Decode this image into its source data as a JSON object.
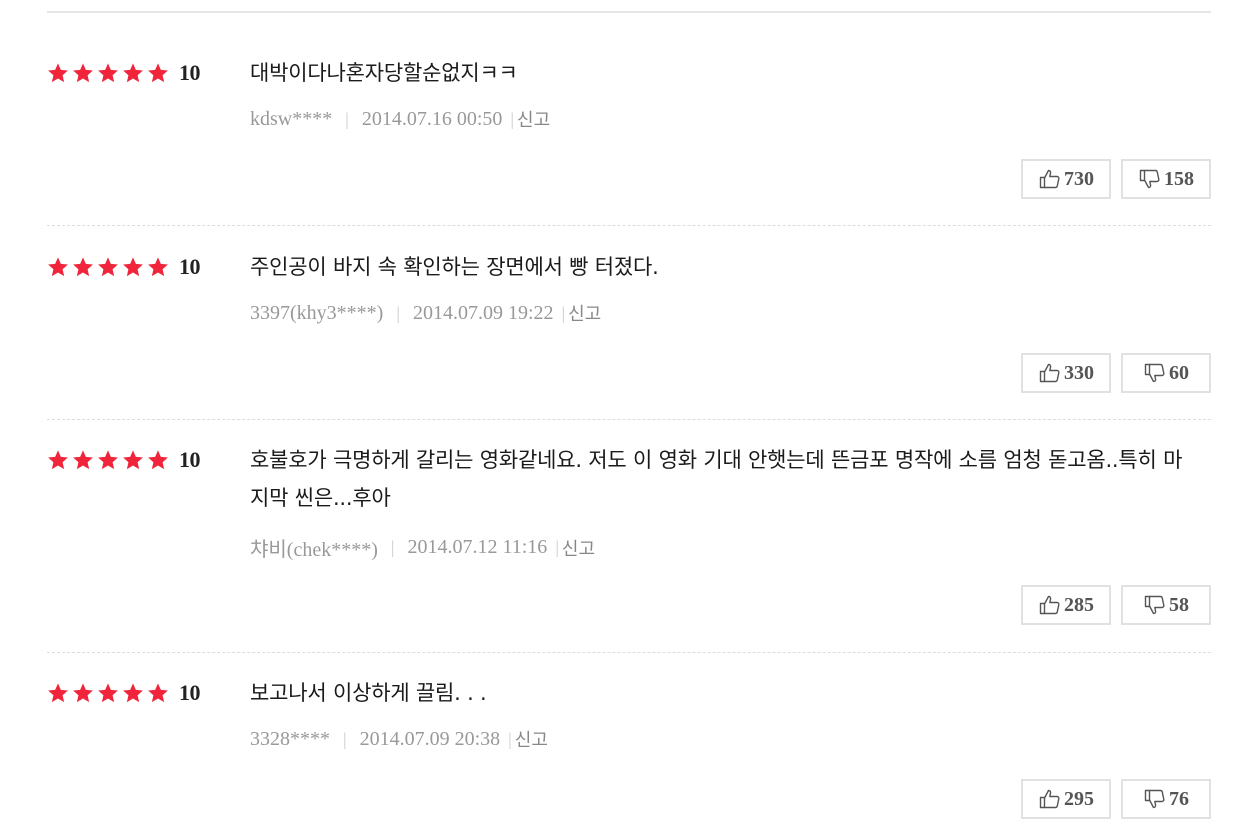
{
  "colors": {
    "star": "#f0243a",
    "meta": "#999999",
    "separator": "#dcdcdc"
  },
  "icons": {
    "star": "star-icon",
    "like": "thumbs-up-icon",
    "dislike": "thumbs-down-icon"
  },
  "reviews": [
    {
      "stars": 5,
      "score": "10",
      "text": "대박이다나혼자당할순없지ㅋㅋ",
      "author": "kdsw****",
      "date": "2014.07.16 00:50",
      "report": "신고",
      "likes": "730",
      "dislikes": "158"
    },
    {
      "stars": 5,
      "score": "10",
      "text": "주인공이 바지 속 확인하는 장면에서 빵 터졌다.",
      "author": "3397(khy3****)",
      "date": "2014.07.09 19:22",
      "report": "신고",
      "likes": "330",
      "dislikes": "60"
    },
    {
      "stars": 5,
      "score": "10",
      "text": "호불호가 극명하게 갈리는 영화같네요. 저도 이 영화 기대 안햇는데 뜬금포 명작에 소름 엄청 돋고옴..특히 마지막 씬은...후아",
      "author": "챠비(chek****)",
      "date": "2014.07.12 11:16",
      "report": "신고",
      "likes": "285",
      "dislikes": "58"
    },
    {
      "stars": 5,
      "score": "10",
      "text": "보고나서 이상하게 끌림. . .",
      "author": "3328****",
      "date": "2014.07.09 20:38",
      "report": "신고",
      "likes": "295",
      "dislikes": "76"
    }
  ]
}
